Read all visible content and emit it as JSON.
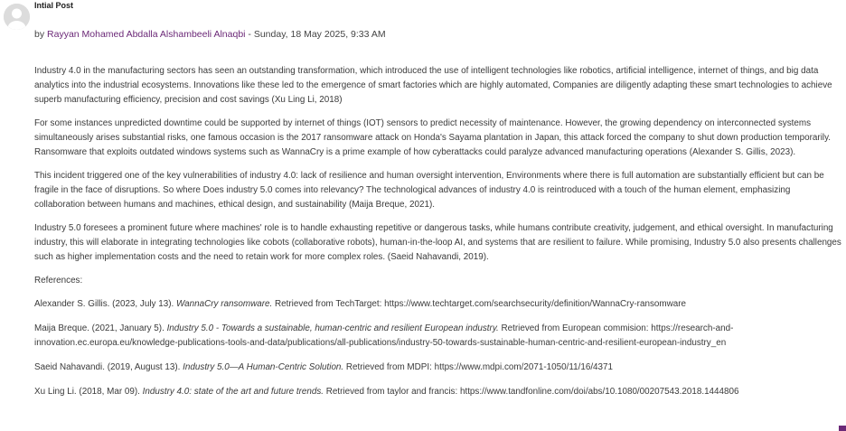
{
  "post": {
    "title": "Intial Post",
    "by_prefix": "by ",
    "author": "Rayyan Mohamed Abdalla Alshambeeli Alnaqbi",
    "date": " - Sunday, 18 May 2025, 9:33 AM",
    "paragraphs": [
      "Industry 4.0 in the manufacturing sectors has seen an outstanding transformation, which introduced the use of intelligent technologies like robotics, artificial intelligence, internet of things, and big data analytics into the industrial ecosystems. Innovations like these led to the emergence of smart factories which are highly automated, Companies are diligently adapting these smart technologies to achieve superb manufacturing efficiency, precision and cost savings (Xu Ling Li, 2018)",
      "For some instances unpredicted downtime could be supported by internet of things (IOT) sensors to predict necessity of maintenance. However, the growing dependency on interconnected systems simultaneously arises substantial risks, one famous occasion is the 2017 ransomware attack on Honda's Sayama plantation in Japan, this attack forced the company to shut down production temporarily. Ransomware that exploits outdated windows systems such as WannaCry is a prime example of how cyberattacks could paralyze advanced manufacturing operations (Alexander S. Gillis, 2023).",
      "This incident triggered one of the key vulnerabilities of industry 4.0: lack of resilience and human oversight intervention, Environments where there is full automation are substantially efficient but can be fragile in the face of disruptions. So where Does industry 5.0 comes into relevancy? The technological advances of industry 4.0 is reintroduced with a touch of the human element, emphasizing collaboration between humans and machines, ethical design, and sustainability (Maija Breque, 2021).",
      "Industry 5.0 foresees a prominent future where machines' role is to handle exhausting repetitive or dangerous tasks, while humans contribute creativity, judgement, and ethical oversight. In manufacturing industry, this will elaborate in integrating technologies like cobots (collaborative robots), human-in-the-loop AI, and systems that are resilient to failure. While promising, Industry 5.0 also presents challenges such as higher implementation costs and the need to retain work for more complex roles. (Saeid Nahavandi, 2019)."
    ],
    "references_label": "References:",
    "references": [
      {
        "pre": "Alexander S. Gillis. (2023, July 13). ",
        "title": "WannaCry ransomware.",
        "post": " Retrieved from TechTarget: https://www.techtarget.com/searchsecurity/definition/WannaCry-ransomware"
      },
      {
        "pre": "Maija Breque. (2021, January 5). ",
        "title": "Industry 5.0 - Towards a sustainable, human-centric and resilient European industry.",
        "post": " Retrieved from European commision: https://research-and-innovation.ec.europa.eu/knowledge-publications-tools-and-data/publications/all-publications/industry-50-towards-sustainable-human-centric-and-resilient-european-industry_en"
      },
      {
        "pre": "Saeid Nahavandi. (2019, August 13). ",
        "title": "Industry 5.0—A Human-Centric Solution.",
        "post": " Retrieved from MDPI: https://www.mdpi.com/2071-1050/11/16/4371"
      },
      {
        "pre": "Xu Ling Li. (2018, Mar 09). ",
        "title": "Industry 4.0: state of the art and future trends.",
        "post": " Retrieved from taylor and francis: https://www.tandfonline.com/doi/abs/10.1080/00207543.2018.1444806"
      }
    ]
  },
  "colors": {
    "author_link": "#6b2877",
    "avatar_bg": "#dcdcdc"
  },
  "icons": {
    "avatar": "default-user-avatar-icon"
  }
}
